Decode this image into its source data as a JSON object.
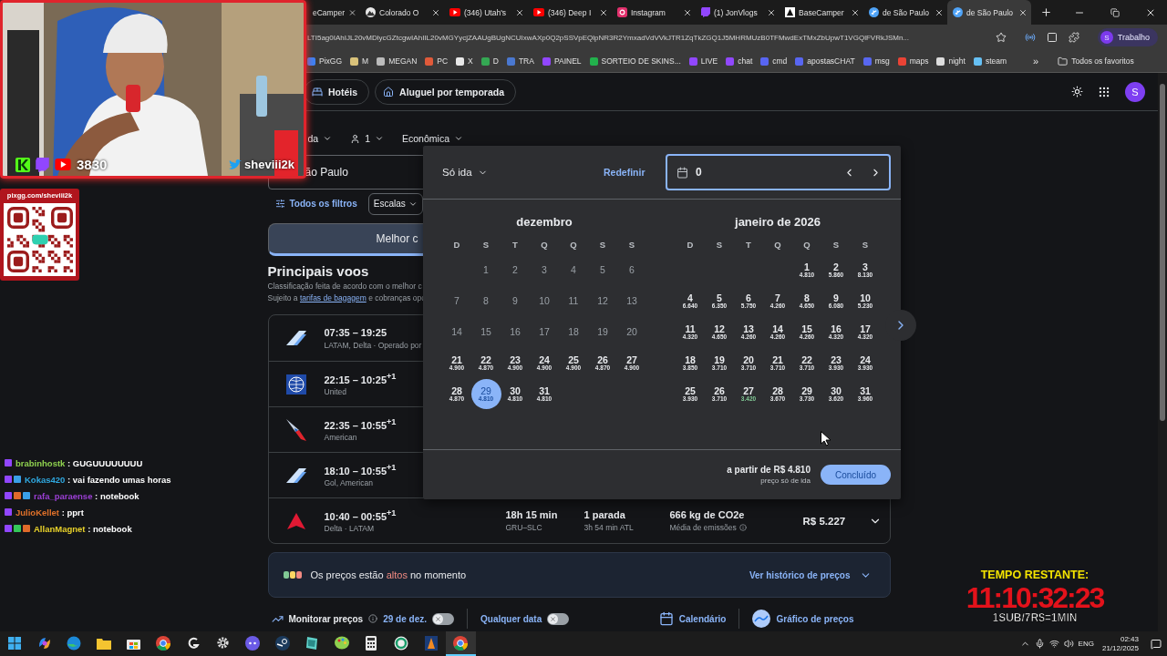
{
  "browser": {
    "tabs": [
      {
        "title": "eCamper",
        "kind": "none",
        "selected": false
      },
      {
        "title": "Colorado O",
        "kind": "mountain",
        "selected": false
      },
      {
        "title": "(346) Utah's",
        "kind": "video",
        "selected": false
      },
      {
        "title": "(346) Deep I",
        "kind": "video",
        "selected": false
      },
      {
        "title": "Instagram",
        "kind": "camera",
        "selected": false
      },
      {
        "title": "(1) JonVlogs",
        "kind": "stream",
        "selected": false
      },
      {
        "title": "BaseCamper",
        "kind": "tent",
        "selected": false
      },
      {
        "title": "de São Paulo",
        "kind": "plane",
        "selected": false
      },
      {
        "title": "de São Paulo",
        "kind": "plane",
        "selected": true
      }
    ],
    "url": "LTI5ag0IAhIJL20vMDlycGZtcgwIAhIIL20vMGYycjZAAUgBUgNCUIxwAXp0Q2pSSVpEQlpNR3R2YmxadVdVVkJTR1ZqTkZGQ1J5MHRMUzB0TFMwdExTMxZbUpwT1VGQlFVRkJSMn...",
    "profile": {
      "initial": "S",
      "label": "Trabalho"
    },
    "bookmarks": [
      {
        "label": "PixGG",
        "color": "#3b82f6"
      },
      {
        "label": "M",
        "color": "#d9c27a"
      },
      {
        "label": "MEGAN",
        "color": "#bbbbbb"
      },
      {
        "label": "PC",
        "color": "#e05a3a"
      },
      {
        "label": "X",
        "color": "#e8e8e8"
      },
      {
        "label": "D",
        "color": "#34a853"
      },
      {
        "label": "TRA",
        "color": "#4a78d0"
      },
      {
        "label": "PAINEL",
        "color": "#9146ff"
      },
      {
        "label": "SORTEIO DE SKINS...",
        "color": "#22b14c"
      },
      {
        "label": "LIVE",
        "color": "#9147fe"
      },
      {
        "label": "chat",
        "color": "#9148fd"
      },
      {
        "label": "cmd",
        "color": "#5865f2"
      },
      {
        "label": "apostasCHAT",
        "color": "#5866f1"
      },
      {
        "label": "msg",
        "color": "#5867f0"
      },
      {
        "label": "maps",
        "color": "#ea4335"
      },
      {
        "label": "night",
        "color": "#dddddd"
      },
      {
        "label": "steam",
        "color": "#66c0f4"
      }
    ],
    "more": "»",
    "all_bookmarks": "Todos os favoritos"
  },
  "flights_page": {
    "header_chips": [
      {
        "label": "Hotéis",
        "kind": "bed"
      },
      {
        "label": "Aluguel por temporada",
        "kind": "house"
      }
    ],
    "avatar": "S",
    "search": {
      "trip": "da",
      "passengers": "1",
      "cabin": "Econômica",
      "origin": "ão Paulo"
    },
    "filters": {
      "all": "Todos os filtros",
      "stops": "Escalas"
    },
    "sort_tabs": [
      {
        "label": "Melhor c",
        "selected": true
      }
    ],
    "section_title": "Principais voos",
    "subtitle": "Classificação feita de acordo com o melhor c",
    "note": {
      "before": "Sujeito a",
      "link": "tarifas de bagagem",
      "after": "e cobranças opc"
    },
    "flights": [
      {
        "kind": "fin",
        "time": "07:35 – 19:25",
        "airline": "LATAM, Delta · Operado por"
      },
      {
        "kind": "globe",
        "time": "22:15 – 10:25$^{+1}$",
        "airline": "United"
      },
      {
        "kind": "swoosh",
        "time": "22:35 – 10:55$^{+1}$",
        "airline": "American"
      },
      {
        "kind": "fin",
        "time": "18:10 – 10:55$^{+1}$",
        "airline": "Gol, American"
      },
      {
        "kind": "triangle",
        "time": "10:40 – 00:55$^{+1}$",
        "airline": "Delta · LATAM",
        "duration": "18h 15 min",
        "route": "GRU–SLC",
        "stops": "1 parada",
        "layover": "3h 54 min ATL",
        "emissions": "666 kg de CO2e",
        "emissions_note": "Média de emissões",
        "price": "R$ 5.227"
      }
    ],
    "price_insight": {
      "prefix": "Os preços estão",
      "highlight": "altos",
      "suffix": "no momento",
      "link": "Ver histórico de preços"
    },
    "tracking": {
      "label": "Monitorar preços",
      "date_toggle": {
        "label": "29 de dez.",
        "on": false
      },
      "any_toggle": {
        "label": "Qualquer data",
        "on": false
      },
      "calendar": "Calendário",
      "chart": "Gráfico de preços"
    }
  },
  "date_picker": {
    "trip": "Só ida",
    "reset": "Redefinir",
    "date_value": "0",
    "months": [
      {
        "title": "dezembro",
        "weekdays": [
          "D",
          "S",
          "T",
          "Q",
          "Q",
          "S",
          "S"
        ],
        "days": [
          {
            "day": "1",
            "disabled": true,
            "selected": false,
            "cheap": false
          },
          {
            "day": "2",
            "disabled": true,
            "selected": false,
            "cheap": false
          },
          {
            "day": "3",
            "disabled": true,
            "selected": false,
            "cheap": false
          },
          {
            "day": "4",
            "disabled": true,
            "selected": false,
            "cheap": false
          },
          {
            "day": "5",
            "disabled": true,
            "selected": false,
            "cheap": false
          },
          {
            "day": "6",
            "disabled": true,
            "selected": false,
            "cheap": false
          },
          {
            "day": "7",
            "disabled": true,
            "selected": false,
            "cheap": false
          },
          {
            "day": "8",
            "disabled": true,
            "selected": false,
            "cheap": false
          },
          {
            "day": "9",
            "disabled": true,
            "selected": false,
            "cheap": false
          },
          {
            "day": "10",
            "disabled": true,
            "selected": false,
            "cheap": false
          },
          {
            "day": "11",
            "disabled": true,
            "selected": false,
            "cheap": false
          },
          {
            "day": "12",
            "disabled": true,
            "selected": false,
            "cheap": false
          },
          {
            "day": "13",
            "disabled": true,
            "selected": false,
            "cheap": false
          },
          {
            "day": "14",
            "disabled": true,
            "selected": false,
            "cheap": false
          },
          {
            "day": "15",
            "disabled": true,
            "selected": false,
            "cheap": false
          },
          {
            "day": "16",
            "disabled": true,
            "selected": false,
            "cheap": false
          },
          {
            "day": "17",
            "disabled": true,
            "selected": false,
            "cheap": false
          },
          {
            "day": "18",
            "disabled": true,
            "selected": false,
            "cheap": false
          },
          {
            "day": "19",
            "disabled": true,
            "selected": false,
            "cheap": false
          },
          {
            "day": "20",
            "disabled": true,
            "selected": false,
            "cheap": false
          },
          {
            "day": "21",
            "price": "4.900",
            "disabled": false,
            "selected": false,
            "cheap": false
          },
          {
            "day": "22",
            "price": "4.870",
            "disabled": false,
            "selected": false,
            "cheap": false
          },
          {
            "day": "23",
            "price": "4.900",
            "disabled": false,
            "selected": false,
            "cheap": false
          },
          {
            "day": "24",
            "price": "4.900",
            "disabled": false,
            "selected": false,
            "cheap": false
          },
          {
            "day": "25",
            "price": "4.900",
            "disabled": false,
            "selected": false,
            "cheap": false
          },
          {
            "day": "26",
            "price": "4.870",
            "disabled": false,
            "selected": false,
            "cheap": false
          },
          {
            "day": "27",
            "price": "4.900",
            "disabled": false,
            "selected": false,
            "cheap": false
          },
          {
            "day": "28",
            "price": "4.870",
            "disabled": false,
            "selected": false,
            "cheap": false
          },
          {
            "day": "29",
            "price": "4.810",
            "disabled": false,
            "selected": true,
            "cheap": false
          },
          {
            "day": "30",
            "price": "4.810",
            "disabled": false,
            "selected": false,
            "cheap": false
          },
          {
            "day": "31",
            "price": "4.810",
            "disabled": false,
            "selected": false,
            "cheap": false
          }
        ]
      },
      {
        "title": "janeiro de 2026",
        "weekdays": [
          "D",
          "S",
          "T",
          "Q",
          "Q",
          "S",
          "S"
        ],
        "days": [
          {
            "day": "1",
            "price": "4.810",
            "disabled": false,
            "selected": false,
            "cheap": false
          },
          {
            "day": "2",
            "price": "5.860",
            "disabled": false,
            "selected": false,
            "cheap": false
          },
          {
            "day": "3",
            "price": "8.130",
            "disabled": false,
            "selected": false,
            "cheap": false
          },
          {
            "day": "4",
            "price": "6.640",
            "disabled": false,
            "selected": false,
            "cheap": false
          },
          {
            "day": "5",
            "price": "6.350",
            "disabled": false,
            "selected": false,
            "cheap": false
          },
          {
            "day": "6",
            "price": "5.750",
            "disabled": false,
            "selected": false,
            "cheap": false
          },
          {
            "day": "7",
            "price": "4.260",
            "disabled": false,
            "selected": false,
            "cheap": false
          },
          {
            "day": "8",
            "price": "4.650",
            "disabled": false,
            "selected": false,
            "cheap": false
          },
          {
            "day": "9",
            "price": "6.080",
            "disabled": false,
            "selected": false,
            "cheap": false
          },
          {
            "day": "10",
            "price": "5.230",
            "disabled": false,
            "selected": false,
            "cheap": false
          },
          {
            "day": "11",
            "price": "4.320",
            "disabled": false,
            "selected": false,
            "cheap": false
          },
          {
            "day": "12",
            "price": "4.650",
            "disabled": false,
            "selected": false,
            "cheap": false
          },
          {
            "day": "13",
            "price": "4.260",
            "disabled": false,
            "selected": false,
            "cheap": false
          },
          {
            "day": "14",
            "price": "4.260",
            "disabled": false,
            "selected": false,
            "cheap": false
          },
          {
            "day": "15",
            "price": "4.260",
            "disabled": false,
            "selected": false,
            "cheap": false
          },
          {
            "day": "16",
            "price": "4.320",
            "disabled": false,
            "selected": false,
            "cheap": false
          },
          {
            "day": "17",
            "price": "4.320",
            "disabled": false,
            "selected": false,
            "cheap": false
          },
          {
            "day": "18",
            "price": "3.850",
            "disabled": false,
            "selected": false,
            "cheap": false
          },
          {
            "day": "19",
            "price": "3.710",
            "disabled": false,
            "selected": false,
            "cheap": false
          },
          {
            "day": "20",
            "price": "3.710",
            "disabled": false,
            "selected": false,
            "cheap": false
          },
          {
            "day": "21",
            "price": "3.710",
            "disabled": false,
            "selected": false,
            "cheap": false
          },
          {
            "day": "22",
            "price": "3.710",
            "disabled": false,
            "selected": false,
            "cheap": false
          },
          {
            "day": "23",
            "price": "3.930",
            "disabled": false,
            "selected": false,
            "cheap": false
          },
          {
            "day": "24",
            "price": "3.930",
            "disabled": false,
            "selected": false,
            "cheap": false
          },
          {
            "day": "25",
            "price": "3.930",
            "disabled": false,
            "selected": false,
            "cheap": false
          },
          {
            "day": "26",
            "price": "3.710",
            "disabled": false,
            "selected": false,
            "cheap": false
          },
          {
            "day": "27",
            "price": "3.420",
            "disabled": false,
            "selected": false,
            "cheap": true
          },
          {
            "day": "28",
            "price": "3.670",
            "disabled": false,
            "selected": false,
            "cheap": false
          },
          {
            "day": "29",
            "price": "3.730",
            "disabled": false,
            "selected": false,
            "cheap": false
          },
          {
            "day": "30",
            "price": "3.620",
            "disabled": false,
            "selected": false,
            "cheap": false
          },
          {
            "day": "31",
            "price": "3.960",
            "disabled": false,
            "selected": false,
            "cheap": false
          }
        ]
      }
    ],
    "from_price": "a partir de R$ 4.810",
    "price_note": "preço só de ida",
    "done": "Concluído"
  },
  "stream_overlay": {
    "webcam": {
      "count": "3830",
      "handle": "sheviii2k"
    },
    "qr": {
      "label": "pixgg.com/sheviii2k"
    },
    "chat": [
      {
        "user": "brabinhostk",
        "color": "#8fd14f",
        "text": ": GUGUUUUUUUU",
        "badges": [
          {
            "kind": "twitch"
          }
        ]
      },
      {
        "user": "Kokas420",
        "color": "#2fa8e0",
        "text": ": vai fazendo umas horas",
        "badges": [
          {
            "kind": "twitch"
          },
          {
            "kind": "sub"
          }
        ]
      },
      {
        "user": "rafa_paraense",
        "color": "#9b3fd4",
        "text": ": notebook",
        "badges": [
          {
            "kind": "twitch"
          },
          {
            "kind": "gift"
          },
          {
            "kind": "sub"
          }
        ]
      },
      {
        "user": "JulioKellet",
        "color": "#e0712a",
        "text": ": pprt",
        "badges": [
          {
            "kind": "twitch"
          }
        ]
      },
      {
        "user": "AllanMagnet",
        "color": "#e8d12a",
        "text": ": notebook",
        "badges": [
          {
            "kind": "twitch"
          },
          {
            "kind": "check"
          },
          {
            "kind": "gift"
          }
        ]
      }
    ],
    "timer": {
      "title": "TEMPO RESTANTE:",
      "time": "11:10:32:23",
      "rule": "1SUB/7R$=1MIN"
    }
  },
  "taskbar": {
    "apps": [
      {
        "kind": "windows",
        "selected": false
      },
      {
        "kind": "copilot",
        "selected": false
      },
      {
        "kind": "edge",
        "selected": false
      },
      {
        "kind": "folder",
        "selected": false
      },
      {
        "kind": "store",
        "selected": false
      },
      {
        "kind": "chrome",
        "selected": false
      },
      {
        "kind": "arrow",
        "selected": false
      },
      {
        "kind": "gear",
        "selected": false
      },
      {
        "kind": "discord",
        "selected": false
      },
      {
        "kind": "steam",
        "selected": false
      },
      {
        "kind": "tablet",
        "selected": false
      },
      {
        "kind": "palette",
        "selected": false
      },
      {
        "kind": "calculator",
        "selected": false
      },
      {
        "kind": "ring",
        "selected": false
      },
      {
        "kind": "cone",
        "selected": false
      },
      {
        "kind": "chrome",
        "selected": true
      }
    ],
    "language": "ENG",
    "time": "02:43",
    "date": "21/12/2025"
  }
}
